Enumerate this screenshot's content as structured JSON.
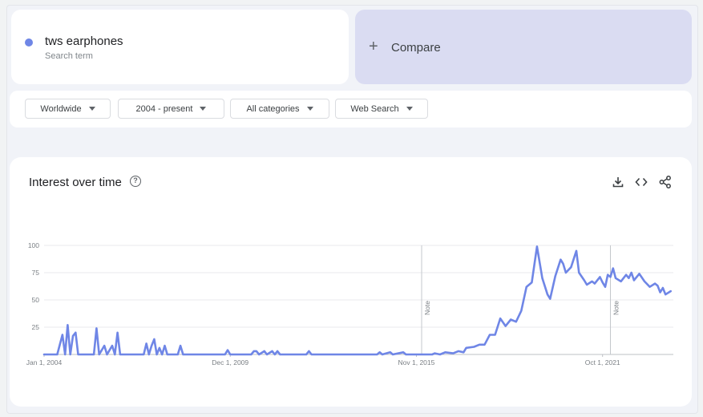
{
  "search_term": {
    "name": "tws earphones",
    "subtitle": "Search term",
    "color": "#6f86e6"
  },
  "compare": {
    "label": "Compare",
    "icon": "plus-icon"
  },
  "filters": [
    {
      "label": "Worldwide"
    },
    {
      "label": "2004 - present"
    },
    {
      "label": "All categories"
    },
    {
      "label": "Web Search"
    }
  ],
  "chart_section": {
    "title": "Interest over time",
    "help_icon": "help-circle-icon",
    "tools": [
      "download-icon",
      "embed-code-icon",
      "share-icon"
    ]
  },
  "chart_data": {
    "type": "line",
    "title": "",
    "xlabel": "",
    "ylabel": "",
    "x_start": "2004-01",
    "x_end": "2024-01",
    "x_tick_labels": [
      "Jan 1, 2004",
      "Dec 1, 2009",
      "Nov 1, 2015",
      "Oct 1, 2021"
    ],
    "y_ticks": [
      25,
      50,
      75,
      100
    ],
    "ylim": [
      0,
      100
    ],
    "grid": true,
    "annotations": [
      {
        "x": "2016-01",
        "text": "Note"
      },
      {
        "x": "2022-01",
        "text": "Note"
      }
    ],
    "series": [
      {
        "color": "#6f86e6",
        "points": [
          [
            "2004-01",
            0
          ],
          [
            "2004-06",
            0
          ],
          [
            "2004-08",
            18
          ],
          [
            "2004-09",
            0
          ],
          [
            "2004-10",
            27
          ],
          [
            "2004-11",
            0
          ],
          [
            "2004-12",
            17
          ],
          [
            "2005-01",
            20
          ],
          [
            "2005-02",
            0
          ],
          [
            "2005-03",
            0
          ],
          [
            "2005-08",
            0
          ],
          [
            "2005-09",
            24
          ],
          [
            "2005-10",
            0
          ],
          [
            "2005-12",
            8
          ],
          [
            "2006-01",
            0
          ],
          [
            "2006-03",
            8
          ],
          [
            "2006-04",
            0
          ],
          [
            "2006-05",
            20
          ],
          [
            "2006-06",
            0
          ],
          [
            "2007-03",
            0
          ],
          [
            "2007-04",
            10
          ],
          [
            "2007-05",
            0
          ],
          [
            "2007-06",
            8
          ],
          [
            "2007-07",
            14
          ],
          [
            "2007-08",
            0
          ],
          [
            "2007-09",
            6
          ],
          [
            "2007-10",
            0
          ],
          [
            "2007-11",
            8
          ],
          [
            "2007-12",
            0
          ],
          [
            "2008-04",
            0
          ],
          [
            "2008-05",
            8
          ],
          [
            "2008-06",
            0
          ],
          [
            "2009-10",
            0
          ],
          [
            "2009-11",
            4
          ],
          [
            "2009-12",
            0
          ],
          [
            "2010-08",
            0
          ],
          [
            "2010-09",
            3
          ],
          [
            "2010-10",
            3
          ],
          [
            "2010-11",
            0
          ],
          [
            "2011-01",
            3
          ],
          [
            "2011-02",
            0
          ],
          [
            "2011-04",
            3
          ],
          [
            "2011-05",
            0
          ],
          [
            "2011-06",
            3
          ],
          [
            "2011-07",
            0
          ],
          [
            "2012-05",
            0
          ],
          [
            "2012-06",
            3
          ],
          [
            "2012-07",
            0
          ],
          [
            "2014-08",
            0
          ],
          [
            "2014-09",
            2
          ],
          [
            "2014-10",
            0
          ],
          [
            "2015-01",
            2
          ],
          [
            "2015-02",
            0
          ],
          [
            "2015-06",
            2
          ],
          [
            "2015-07",
            0
          ],
          [
            "2015-08",
            0
          ],
          [
            "2016-05",
            0
          ],
          [
            "2016-06",
            1
          ],
          [
            "2016-08",
            0
          ],
          [
            "2016-10",
            2
          ],
          [
            "2017-01",
            1
          ],
          [
            "2017-03",
            3
          ],
          [
            "2017-05",
            2
          ],
          [
            "2017-06",
            6
          ],
          [
            "2017-09",
            7
          ],
          [
            "2017-11",
            9
          ],
          [
            "2018-01",
            9
          ],
          [
            "2018-03",
            18
          ],
          [
            "2018-05",
            18
          ],
          [
            "2018-07",
            33
          ],
          [
            "2018-09",
            26
          ],
          [
            "2018-11",
            32
          ],
          [
            "2019-01",
            30
          ],
          [
            "2019-03",
            40
          ],
          [
            "2019-05",
            62
          ],
          [
            "2019-07",
            66
          ],
          [
            "2019-09",
            99
          ],
          [
            "2019-11",
            70
          ],
          [
            "2020-01",
            55
          ],
          [
            "2020-02",
            51
          ],
          [
            "2020-04",
            72
          ],
          [
            "2020-06",
            87
          ],
          [
            "2020-07",
            83
          ],
          [
            "2020-08",
            75
          ],
          [
            "2020-10",
            80
          ],
          [
            "2020-12",
            95
          ],
          [
            "2021-01",
            75
          ],
          [
            "2021-03",
            68
          ],
          [
            "2021-04",
            64
          ],
          [
            "2021-06",
            67
          ],
          [
            "2021-07",
            65
          ],
          [
            "2021-09",
            71
          ],
          [
            "2021-10",
            66
          ],
          [
            "2021-11",
            62
          ],
          [
            "2021-12",
            73
          ],
          [
            "2022-01",
            71
          ],
          [
            "2022-02",
            79
          ],
          [
            "2022-03",
            70
          ],
          [
            "2022-05",
            67
          ],
          [
            "2022-07",
            73
          ],
          [
            "2022-08",
            70
          ],
          [
            "2022-09",
            75
          ],
          [
            "2022-10",
            68
          ],
          [
            "2022-12",
            74
          ],
          [
            "2023-02",
            67
          ],
          [
            "2023-04",
            62
          ],
          [
            "2023-06",
            65
          ],
          [
            "2023-07",
            63
          ],
          [
            "2023-08",
            57
          ],
          [
            "2023-09",
            61
          ],
          [
            "2023-10",
            55
          ],
          [
            "2023-12",
            58
          ]
        ]
      }
    ]
  }
}
